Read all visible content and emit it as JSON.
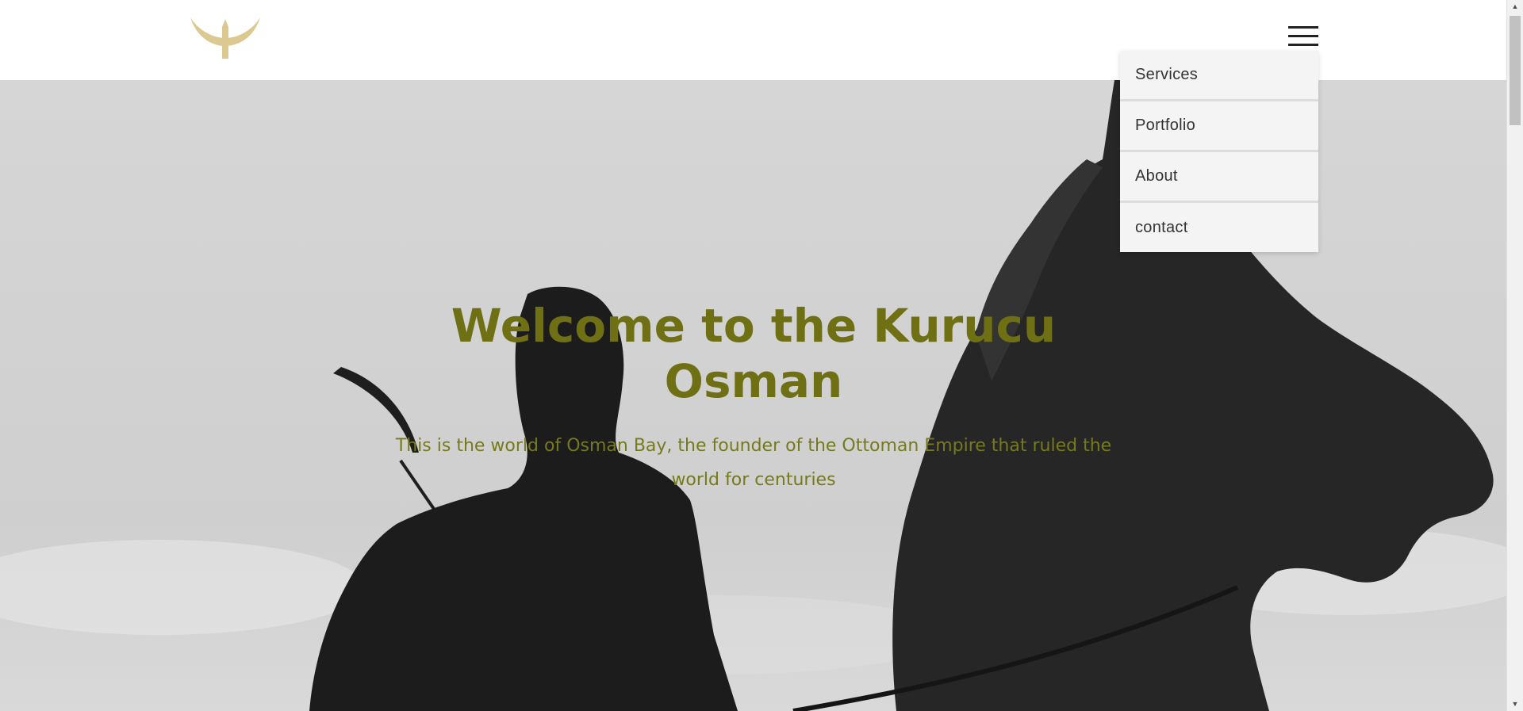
{
  "header": {
    "logo_icon": "bird-emblem-icon",
    "menu_icon": "hamburger-menu-icon"
  },
  "menu": {
    "items": [
      {
        "label": "Services"
      },
      {
        "label": "Portfolio"
      },
      {
        "label": "About"
      },
      {
        "label": "contact"
      }
    ]
  },
  "hero": {
    "title": "Welcome to the Kurucu Osman",
    "subtitle": "This is the world of Osman Bay, the founder of the Ottoman Empire that ruled the world for centuries"
  },
  "colors": {
    "accent": "#6f7013",
    "logo": "#d9c58f"
  }
}
